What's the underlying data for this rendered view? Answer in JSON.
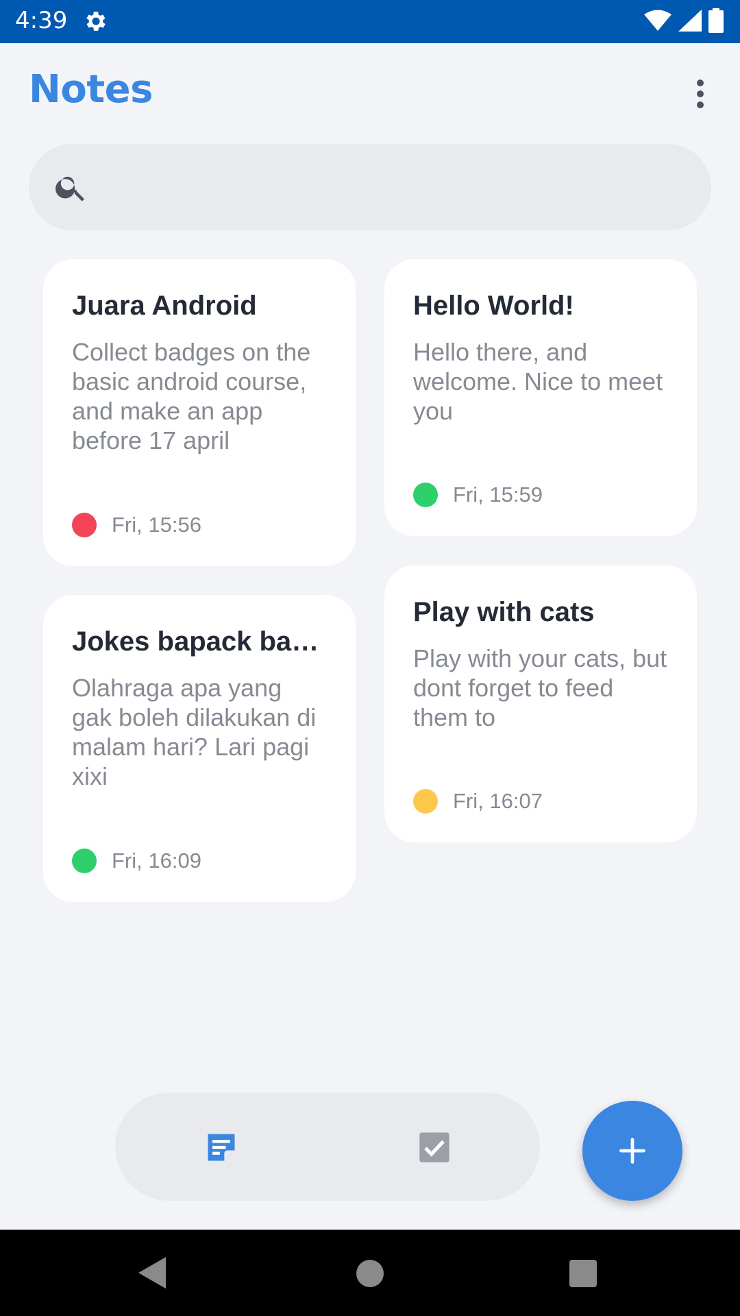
{
  "status_bar": {
    "time": "4:39",
    "icons": [
      "settings-icon",
      "wifi-icon",
      "cell-signal-icon",
      "battery-icon"
    ]
  },
  "header": {
    "title": "Notes",
    "menu_icon": "more-vert-icon"
  },
  "search": {
    "placeholder": "",
    "value": "",
    "icon": "search-icon"
  },
  "notes": [
    {
      "title": "Juara Android",
      "body": "Collect badges on the basic android course, and make an app before 17 april",
      "date": "Fri, 15:56",
      "color": "#f34557"
    },
    {
      "title": "Hello World!",
      "body": "Hello there, and welcome. Nice to meet you",
      "date": "Fri, 15:59",
      "color": "#2fcf6c"
    },
    {
      "title": "Jokes bapack bapack",
      "body": "Olahraga apa yang gak boleh dilakukan di malam hari? Lari pagi xixi",
      "date": "Fri, 16:09",
      "color": "#2fcf6c"
    },
    {
      "title": "Play with cats",
      "body": "Play with your cats, but dont forget to feed them to",
      "date": "Fri, 16:07",
      "color": "#fcc84c"
    }
  ],
  "bottom_nav": {
    "items": [
      {
        "icon": "notes-icon",
        "active": true
      },
      {
        "icon": "checkbox-icon",
        "active": false
      }
    ]
  },
  "fab": {
    "icon": "add-icon"
  },
  "system_nav": {
    "icons": [
      "back-icon",
      "home-icon",
      "recents-icon"
    ]
  },
  "colors": {
    "accent": "#3a86e0",
    "status_bar": "#0059b0",
    "background": "#f3f4f8"
  }
}
